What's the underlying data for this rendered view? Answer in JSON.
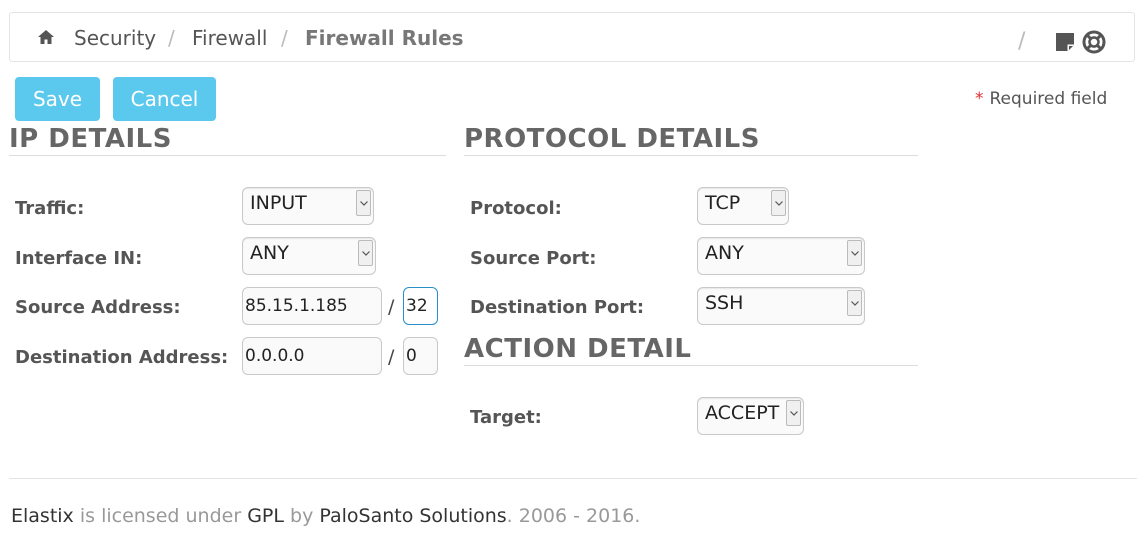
{
  "breadcrumb": {
    "items": [
      "Security",
      "Firewall",
      "Firewall Rules"
    ],
    "separator": "/"
  },
  "toolbar": {
    "save_label": "Save",
    "cancel_label": "Cancel",
    "required_star": "*",
    "required_text": "Required field"
  },
  "ip_details": {
    "title": "IP DETAILS",
    "traffic": {
      "label": "Traffic:",
      "value": "INPUT"
    },
    "interface_in": {
      "label": "Interface IN:",
      "value": "ANY"
    },
    "source_address": {
      "label": "Source Address:",
      "value": "85.15.1.185",
      "mask": "32"
    },
    "destination_address": {
      "label": "Destination Address:",
      "value": "0.0.0.0",
      "mask": "0"
    },
    "mask_separator": "/"
  },
  "protocol_details": {
    "title": "PROTOCOL DETAILS",
    "protocol": {
      "label": "Protocol:",
      "value": "TCP"
    },
    "source_port": {
      "label": "Source Port:",
      "value": "ANY"
    },
    "destination_port": {
      "label": "Destination Port:",
      "value": "SSH"
    }
  },
  "action_detail": {
    "title": "ACTION DETAIL",
    "target": {
      "label": "Target:",
      "value": "ACCEPT"
    }
  },
  "footer": {
    "product": "Elastix",
    "text1": " is licensed under ",
    "license": "GPL",
    "text2": " by ",
    "company": "PaloSanto Solutions",
    "text3": ". 2006 - 2016."
  },
  "colors": {
    "button": "#5bc9ee",
    "required_star": "#e32d2d",
    "focus_border": "#2a8fc7"
  },
  "icons": {
    "home": "home-icon",
    "note": "sticky-note-icon",
    "help": "life-ring-icon",
    "dropdown": "chevron-down-icon"
  }
}
